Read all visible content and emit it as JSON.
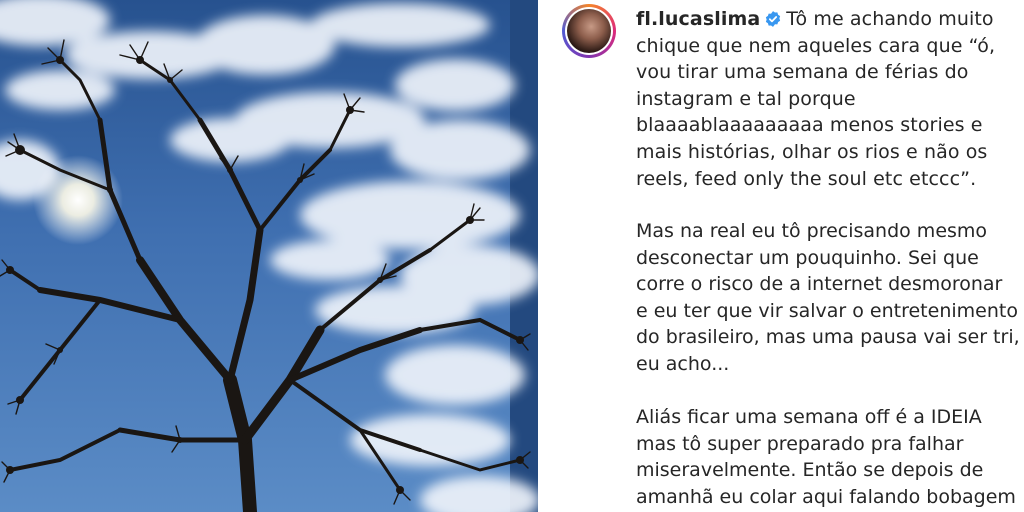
{
  "post": {
    "username": "fl.lucaslima",
    "verified_icon": "verified-badge-icon",
    "caption_first_line": "Tô me achando muito",
    "caption_paragraph_1_rest": "chique que nem aqueles cara que “ó, vou tirar uma semana de férias do instagram e tal porque blaaaablaaaaaaaaa menos stories e mais histórias, olhar os rios e não os reels, feed only the soul etc etccc”.",
    "caption_paragraph_2": "Mas na real eu tô precisando mesmo desconectar um pouquinho. Sei que corre o risco de a internet desmoronar e eu ter que vir salvar o entretenimento do brasileiro, mas uma pausa vai ser tri, eu acho...",
    "caption_paragraph_3": "Aliás ficar uma semana off é a IDEIA mas tô super preparado pra falhar miseravelmente. Então se depois de amanhã eu colar aqui falando bobagem"
  },
  "colors": {
    "text": "#262626",
    "verified_blue": "#3897f0",
    "sky_top": "#27528f",
    "sky_bottom": "#5b8cc6"
  }
}
